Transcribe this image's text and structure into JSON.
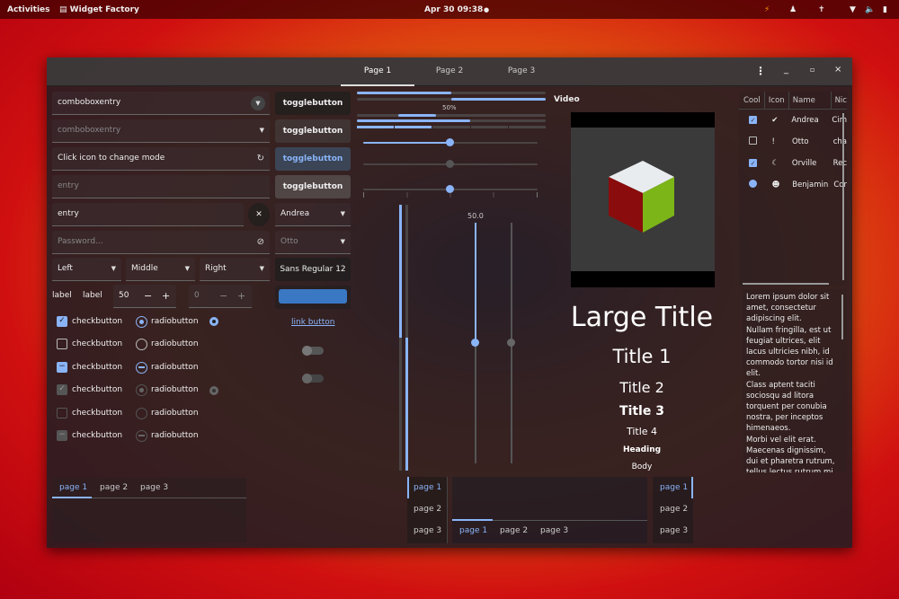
{
  "topbar": {
    "activities": "Activities",
    "app": "Widget Factory",
    "clock": "Apr 30  09:38"
  },
  "header": {
    "tabs": [
      "Page 1",
      "Page 2",
      "Page 3"
    ]
  },
  "entries": {
    "combo1": "comboboxentry",
    "combo2": "comboboxentry",
    "mode": "Click icon to change mode",
    "entry_placeholder": "entry",
    "entry_value": "entry",
    "password_placeholder": "Password..."
  },
  "toggles": [
    "togglebutton",
    "togglebutton",
    "togglebutton",
    "togglebutton"
  ],
  "combos": {
    "name1": "Andrea",
    "name2": "Otto",
    "left": "Left",
    "middle": "Middle",
    "right": "Right",
    "font": "Sans Regular  12"
  },
  "labels": {
    "label1": "label",
    "label2": "label"
  },
  "spin": {
    "value1": "50",
    "value2": "0",
    "minus": "−",
    "plus": "+"
  },
  "checks": [
    "checkbutton",
    "checkbutton",
    "checkbutton",
    "checkbutton",
    "checkbutton",
    "checkbutton"
  ],
  "radios": [
    "radiobutton",
    "radiobutton",
    "radiobutton",
    "radiobutton",
    "radiobutton",
    "radiobutton"
  ],
  "link": "link button",
  "progress": {
    "label": "50%",
    "value": 0.5
  },
  "scale": {
    "label": "50.0",
    "value": 50
  },
  "video": {
    "label": "Video"
  },
  "titles": {
    "large": "Large Title",
    "t1": "Title 1",
    "t2": "Title 2",
    "t3": "Title 3",
    "t4": "Title 4",
    "heading": "Heading",
    "body": "Body"
  },
  "tree": {
    "columns": [
      "Cool",
      "Icon",
      "Name",
      "Nic"
    ],
    "rows": [
      {
        "name": "Andrea",
        "nick": "Cim"
      },
      {
        "name": "Otto",
        "nick": "cha"
      },
      {
        "name": "Orville",
        "nick": "Rec"
      },
      {
        "name": "Benjamin",
        "nick": "Cor"
      }
    ]
  },
  "textview": "Lorem ipsum dolor sit amet, consectetur adipiscing elit.\nNullam fringilla, est ut feugiat ultrices, elit lacus ultricies nibh, id commodo tortor nisi id elit.\nClass aptent taciti sociosqu ad litora torquent per conubia nostra, per inceptos himenaeos.\nMorbi vel elit erat. Maecenas dignissim, dui et pharetra rutrum, tellus lectus rutrum mi",
  "notebook": {
    "tabs": [
      "page 1",
      "page 2",
      "page 3"
    ]
  },
  "accent": "#8ab4f8"
}
